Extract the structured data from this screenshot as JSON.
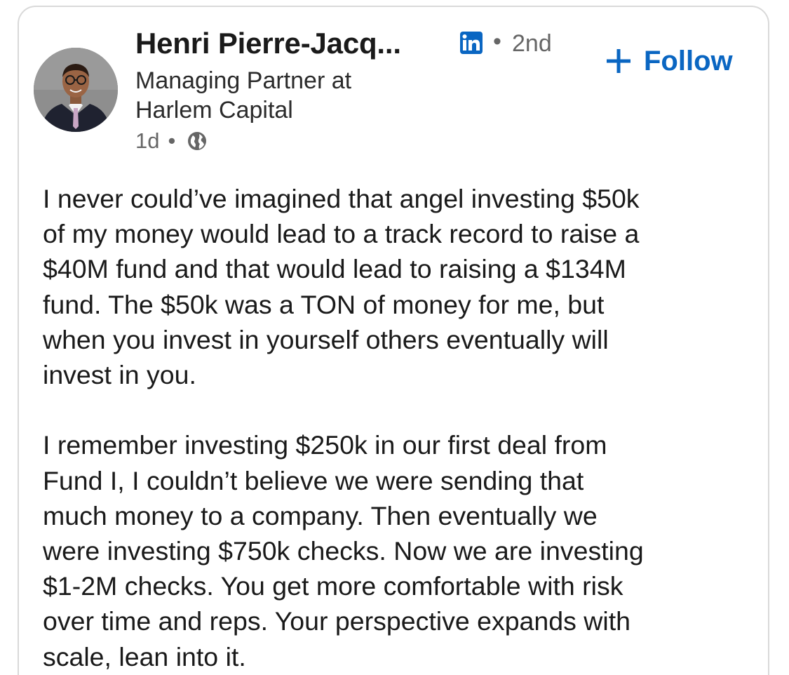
{
  "author": {
    "name": "Henri Pierre-Jacq...",
    "badge_icon": "linkedin-icon",
    "separator": "•",
    "connection_degree": "2nd",
    "headline_line1": "Managing Partner at",
    "headline_line2": "Harlem Capital",
    "avatar_icon": "profile-photo"
  },
  "follow": {
    "plus_icon": "plus-icon",
    "label": "Follow"
  },
  "meta": {
    "age": "1d",
    "separator": "•",
    "visibility_icon": "globe-icon"
  },
  "post": {
    "lines_p1": [
      "I never could’ve imagined that angel investing $50k",
      "of my money would lead to a track record to raise a",
      "$40M fund and that would lead to raising a $134M",
      "fund. The $50k was a TON of money for me, but",
      "when you invest in yourself others eventually will",
      "invest in you."
    ],
    "lines_p2": [
      "I remember investing $250k in our first deal from",
      "Fund I, I couldn’t believe we were sending that",
      "much money to a company. Then eventually we",
      "were investing $750k checks. Now we are investing",
      "$1-2M checks. You get more comfortable with risk",
      "over time and reps. Your perspective expands with",
      "scale, lean into it."
    ]
  },
  "colors": {
    "accent": "#0a66c2",
    "secondary_text": "#666666",
    "border": "#d9d9d9"
  }
}
